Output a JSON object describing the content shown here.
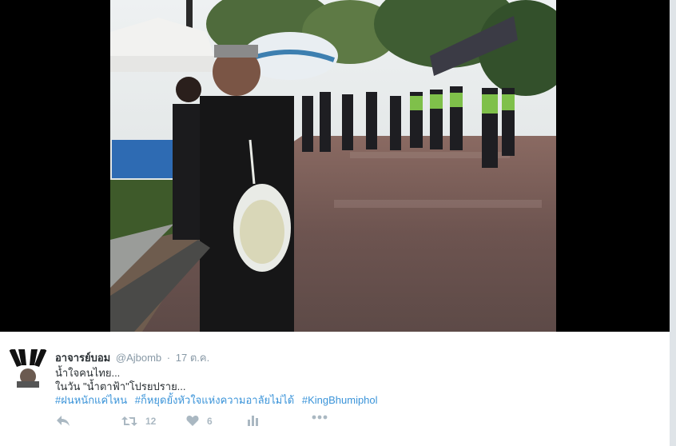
{
  "tweet": {
    "fullname": "อาจารย์บอม",
    "handle": "@Ajbomb",
    "separator": "·",
    "timestamp": "17 ต.ค.",
    "lines": [
      "น้ำใจคนไทย...",
      "ในวัน \"น้ำตาฟ้า\"โปรยปราย..."
    ],
    "hashtags": [
      "#ฝนหนักแค่ไหน",
      "#ก็หยุดยั้งหัวใจแห่งความอาลัยไม่ได้",
      "#KingBhumiphol"
    ],
    "actions": {
      "reply_icon": "reply-icon",
      "retweet_icon": "retweet-icon",
      "retweet_count": "12",
      "like_icon": "heart-icon",
      "like_count": "6",
      "analytics_icon": "analytics-icon",
      "more_icon": "more-icon"
    }
  },
  "colors": {
    "hashtag": "#3b94d9",
    "action_gray": "#aab8c2",
    "meta_gray": "#8899a6",
    "text": "#292f33",
    "media_background": "#000000"
  }
}
